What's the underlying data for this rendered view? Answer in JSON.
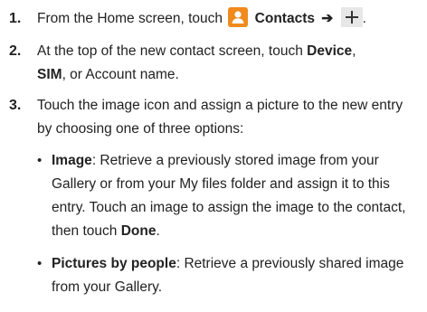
{
  "steps": [
    {
      "number": "1.",
      "parts": [
        "From the Home screen, touch",
        "Contacts",
        "➔",
        "."
      ]
    },
    {
      "number": "2.",
      "parts": [
        "At the top of the new contact screen, touch",
        "Device",
        ",",
        "SIM",
        ", or Account name."
      ]
    },
    {
      "number": "3.",
      "text": "Touch the image icon and assign a picture to the new entry by choosing one of three options:"
    }
  ],
  "options": [
    {
      "title": "Image",
      "text": ": Retrieve a previously stored image from your Gallery or from your My files folder and assign it to this entry. Touch an image to assign the image to the contact, then touch",
      "emphasis": "Done",
      "end": "."
    },
    {
      "title": "Pictures by people",
      "text": ": Retrieve a previously shared image from your Gallery."
    }
  ],
  "bullet": "•",
  "icons": {
    "contacts": "contacts-app-icon",
    "add": "plus-icon",
    "contacts_color": "#f08a1c"
  }
}
